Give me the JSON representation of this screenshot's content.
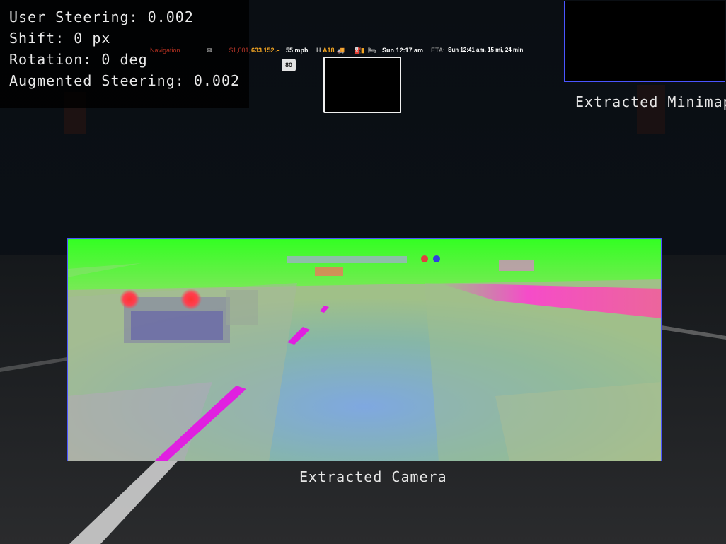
{
  "overlay": {
    "user_steering": "User Steering: 0.002",
    "shift": "Shift: 0 px",
    "rotation": "Rotation: 0 deg",
    "augmented_steering": "Augmented Steering: 0.002"
  },
  "hud": {
    "navigation": "Navigation",
    "money_prefix": "$1,001,",
    "money_highlight": "633,152",
    "money_suffix": ".-",
    "speed": "55 mph",
    "road": "A18",
    "time": "Sun 12:17 am",
    "eta_label": "ETA:",
    "eta_value": "Sun 12:41 am, 15 mi, 24 min",
    "speed_limit": "80",
    "icons": [
      "mail-icon",
      "truck-icon",
      "fuel-icon",
      "bed-icon"
    ]
  },
  "labels": {
    "extracted_minimap": "Extracted Minimap",
    "extracted_camera": "Extracted Camera"
  },
  "colors": {
    "overlay_text": "#e9e9e9",
    "frame_border": "#4a55ff",
    "hud_money": "#f5a623",
    "hud_navigation": "#c0392b",
    "route_red": "#d0161b",
    "map_tan": "#e8c88a",
    "camera_green": "#3cff3c",
    "camera_magenta": "#ff2fd0",
    "camera_blue": "#6aa8e8"
  }
}
